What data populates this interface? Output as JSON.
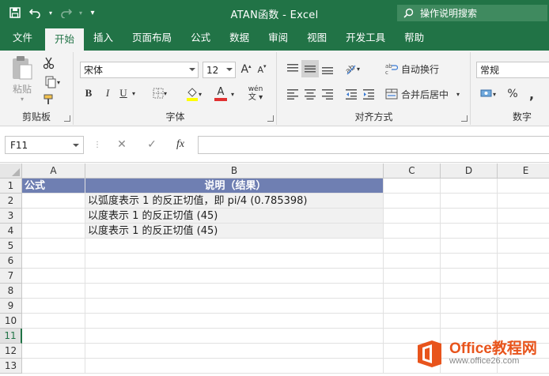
{
  "titlebar": {
    "title": "ATAN函数  -  Excel",
    "tellme": "操作说明搜索"
  },
  "tabs": [
    "文件",
    "开始",
    "插入",
    "页面布局",
    "公式",
    "数据",
    "审阅",
    "视图",
    "开发工具",
    "帮助"
  ],
  "ribbon": {
    "clipboard": {
      "paste_label": "粘贴",
      "group_label": "剪贴板"
    },
    "font": {
      "font_name": "宋体",
      "font_size": "12",
      "group_label": "字体",
      "bold": "B",
      "italic": "I",
      "underline": "U",
      "grow": "A",
      "shrink": "A",
      "fontcolor": "A",
      "wen": "wén"
    },
    "alignment": {
      "wrap_label": "自动换行",
      "merge_label": "合并后居中",
      "group_label": "对齐方式"
    },
    "number": {
      "format": "常规",
      "percent": "%",
      "comma": ",",
      "group_label": "数字"
    }
  },
  "formula_bar": {
    "name_box": "F11",
    "fx": "fx",
    "value": ""
  },
  "sheet": {
    "columns": [
      "A",
      "B",
      "C",
      "D",
      "E"
    ],
    "rows": [
      "1",
      "2",
      "3",
      "4",
      "5",
      "6",
      "7",
      "8",
      "9",
      "10",
      "11",
      "12",
      "13"
    ],
    "active_row": "11",
    "cells": {
      "a1": "公式",
      "b1": "说明（结果）",
      "b2": "以弧度表示 1 的反正切值，即 pi/4 (0.785398)",
      "b3": "以度表示 1 的反正切值 (45)",
      "b4": "以度表示 1 的反正切值 (45)"
    }
  },
  "watermark": {
    "line1": "Office教程网",
    "line2": "www.office26.com"
  },
  "colors": {
    "excel_green": "#217346",
    "header_fill": "#6f7fb2",
    "watermark_orange": "#e8541c"
  }
}
